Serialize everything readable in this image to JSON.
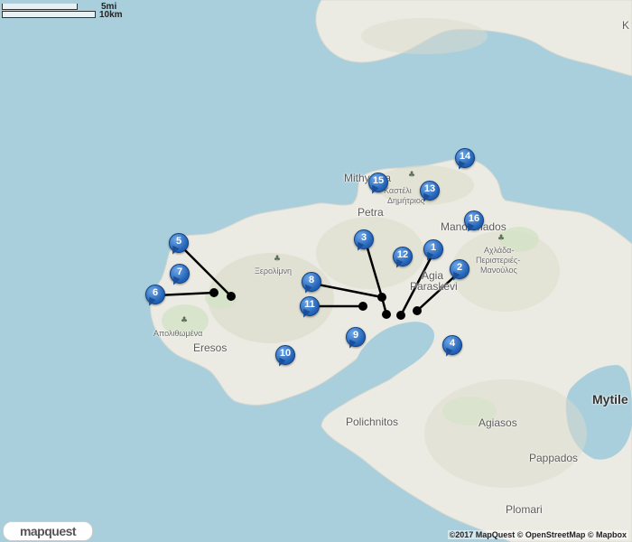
{
  "scale": {
    "miles_label": "5mi",
    "km_label": "10km"
  },
  "logo_text": "mapquest",
  "attribution": "©2017 MapQuest © OpenStreetMap © Mapbox",
  "colors": {
    "water": "#a9cfdd",
    "land": "#ecebe3",
    "relief": "#dbdccb",
    "marker": "#1f5fb4",
    "line": "#000000"
  },
  "places": [
    {
      "id": "mithymna",
      "label": "Mithymna",
      "kind": "town"
    },
    {
      "id": "petra",
      "label": "Petra",
      "kind": "town"
    },
    {
      "id": "kastelli",
      "label": "Καστέλι",
      "kind": "small"
    },
    {
      "id": "dimitrios",
      "label": "Δημήτριος",
      "kind": "small"
    },
    {
      "id": "mandamados",
      "label": "Mandamados",
      "kind": "town"
    },
    {
      "id": "achlada",
      "label": "Αχλάδα-",
      "kind": "small"
    },
    {
      "id": "peristeries",
      "label": "Περιστεριές-",
      "kind": "small"
    },
    {
      "id": "manoulos",
      "label": "Μανούλος",
      "kind": "small"
    },
    {
      "id": "agia",
      "label": "Agia",
      "kind": "town"
    },
    {
      "id": "paraskevi",
      "label": "Paraskevi",
      "kind": "town"
    },
    {
      "id": "xerolimni",
      "label": "Ξερολίμνη",
      "kind": "small"
    },
    {
      "id": "apolithomena",
      "label": "Απολιθωμένα",
      "kind": "small"
    },
    {
      "id": "eresos",
      "label": "Eresos",
      "kind": "town"
    },
    {
      "id": "polichnitos",
      "label": "Polichnitos",
      "kind": "town"
    },
    {
      "id": "agiasos",
      "label": "Agiasos",
      "kind": "town"
    },
    {
      "id": "pappados",
      "label": "Pappados",
      "kind": "town"
    },
    {
      "id": "plomari",
      "label": "Plomari",
      "kind": "town"
    },
    {
      "id": "mytilene",
      "label": "Mytile",
      "kind": "city"
    },
    {
      "id": "k_edge",
      "label": "Κ",
      "kind": "town"
    }
  ],
  "markers": [
    "1",
    "2",
    "3",
    "4",
    "5",
    "6",
    "7",
    "8",
    "9",
    "10",
    "11",
    "12",
    "13",
    "14",
    "15",
    "16"
  ]
}
